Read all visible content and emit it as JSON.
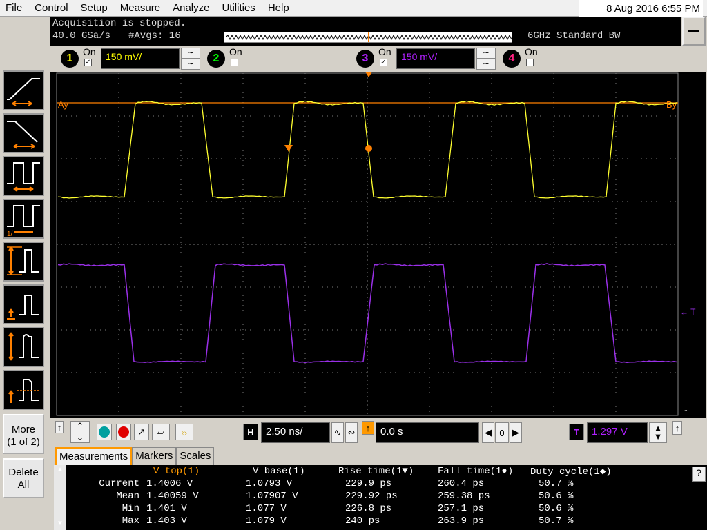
{
  "menu": {
    "items": [
      "File",
      "Control",
      "Setup",
      "Measure",
      "Analyze",
      "Utilities",
      "Help"
    ],
    "datetime": "8 Aug 2016  6:55 PM"
  },
  "acquisition": {
    "status": "Acquisition is stopped.",
    "sample_rate": "40.0 GSa/s",
    "averages": "#Avgs: 16",
    "bandwidth": "6GHz Standard BW"
  },
  "channels": [
    {
      "num": "1",
      "on_label": "On",
      "checked": true,
      "scale": "150 mV/",
      "color": "#ffff00"
    },
    {
      "num": "2",
      "on_label": "On",
      "checked": false,
      "scale": "",
      "color": "#00ff00"
    },
    {
      "num": "3",
      "on_label": "On",
      "checked": true,
      "scale": "150 mV/",
      "color": "#b020ff"
    },
    {
      "num": "4",
      "on_label": "On",
      "checked": false,
      "scale": "",
      "color": "#ff2080"
    }
  ],
  "screen": {
    "marker_a": "Ay",
    "marker_b": "By",
    "trigger_marker": "T",
    "colors": {
      "ch1": "#ffff30",
      "ch3": "#9a30e8",
      "marker": "#ff8000",
      "grid": "#777777"
    }
  },
  "left_toolbar": {
    "more_label": "More",
    "more_sub": "(1 of 2)",
    "delete_label": "Delete",
    "delete_sub": "All"
  },
  "horizontal": {
    "h_label": "H",
    "timebase": "2.50 ns/",
    "position": "0.0 s",
    "zero_label": "0",
    "t_label": "T",
    "trigger_level": "1.297 V"
  },
  "measurements": {
    "tabs": [
      "Measurements",
      "Markers",
      "Scales"
    ],
    "headers": [
      "V top(1)",
      "V base(1)",
      "Rise time(1▼)",
      "Fall time(1●)",
      "Duty cycle(1◆)"
    ],
    "rows": [
      {
        "label": "Current",
        "values": [
          "1.4006 V",
          "1.0793 V",
          "229.9 ps",
          "260.4 ps",
          "50.7 %"
        ]
      },
      {
        "label": "Mean",
        "values": [
          "1.40059 V",
          "1.07907 V",
          "229.92 ps",
          "259.38 ps",
          "50.6 %"
        ]
      },
      {
        "label": "Min",
        "values": [
          "1.401 V",
          "1.077 V",
          "226.8 ps",
          "257.1 ps",
          "50.6 %"
        ]
      },
      {
        "label": "Max",
        "values": [
          "1.403 V",
          "1.079 V",
          "240 ps",
          "263.9 ps",
          "50.7 %"
        ]
      }
    ],
    "help": "?"
  }
}
